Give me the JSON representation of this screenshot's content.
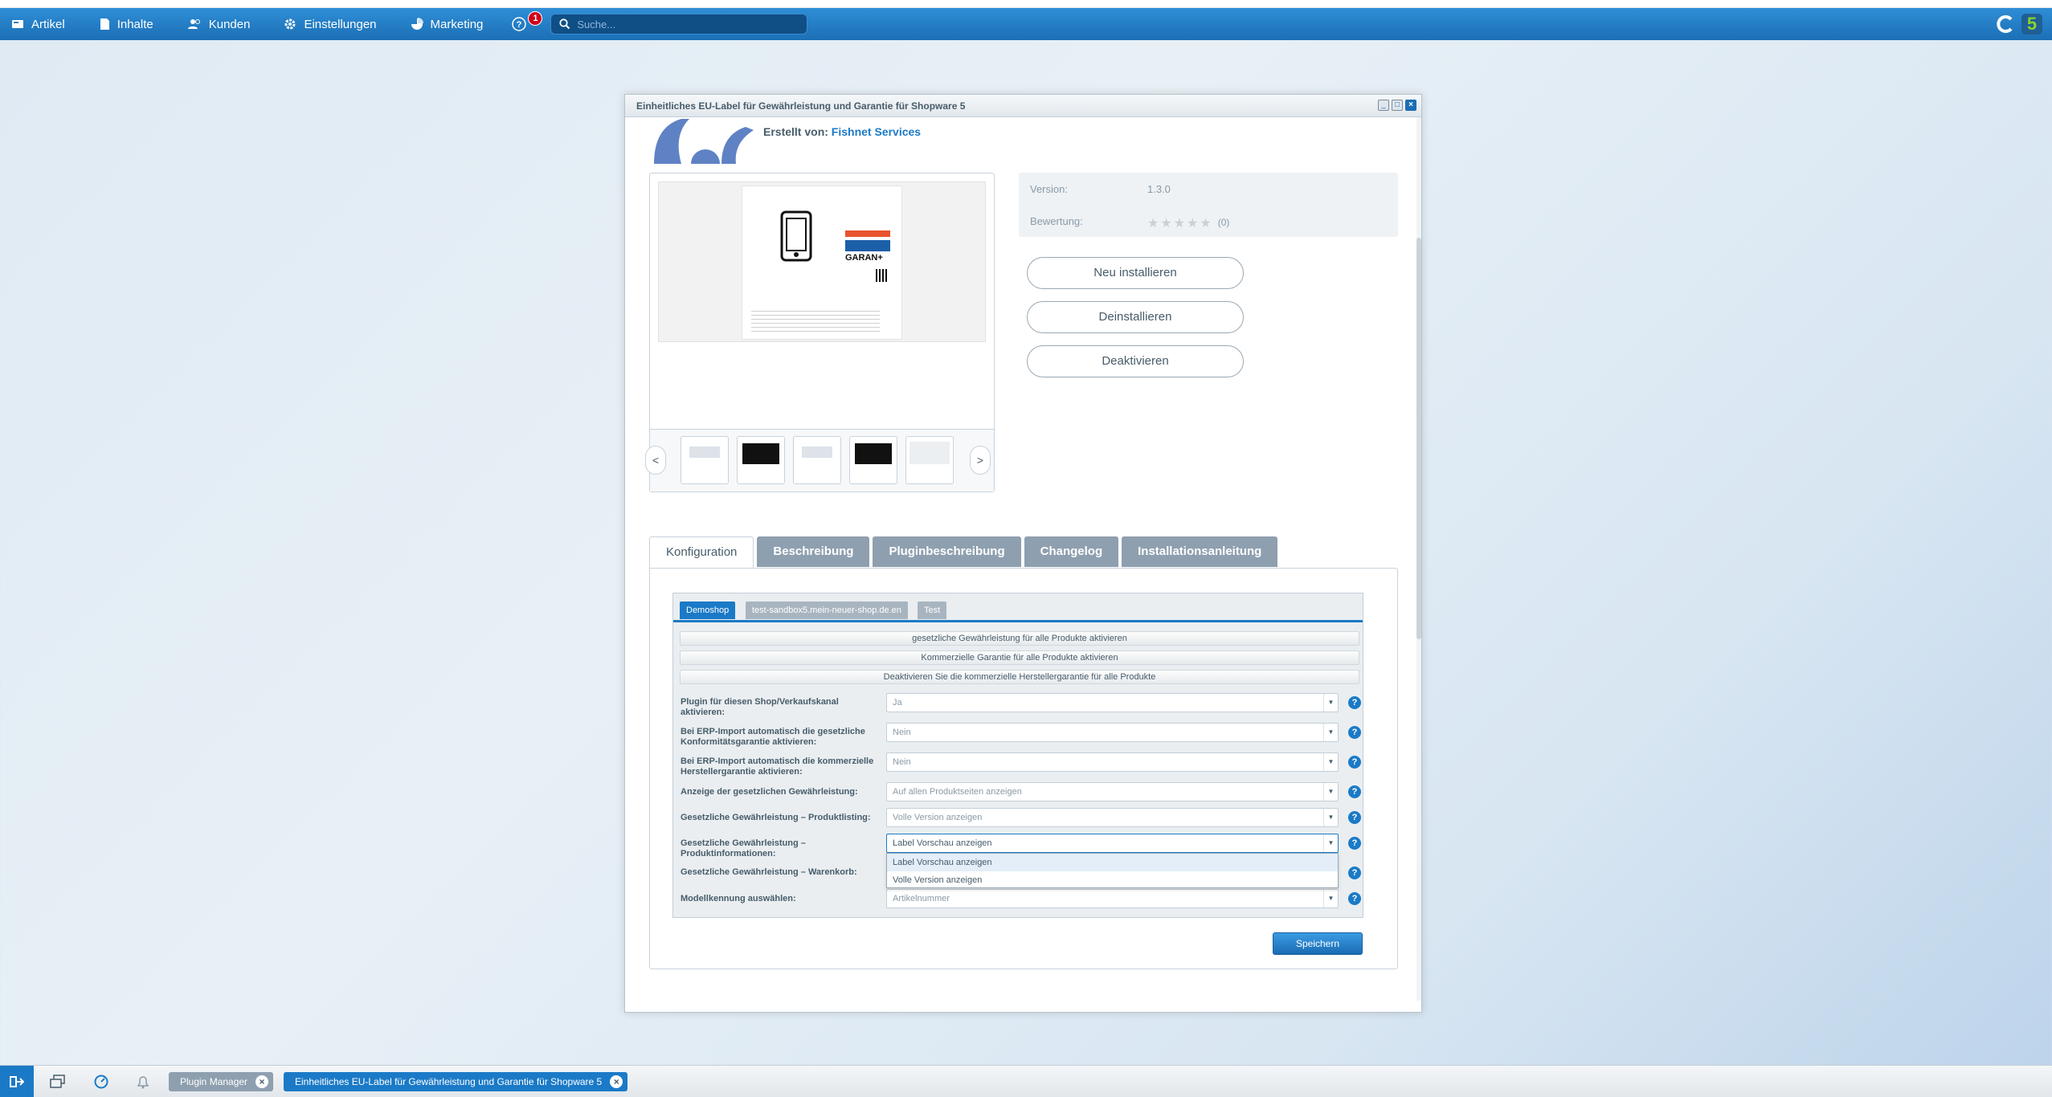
{
  "topbar": {
    "menu": [
      {
        "label": "Artikel",
        "icon": "article-icon"
      },
      {
        "label": "Inhalte",
        "icon": "content-icon"
      },
      {
        "label": "Kunden",
        "icon": "customers-icon"
      },
      {
        "label": "Einstellungen",
        "icon": "gear-icon"
      },
      {
        "label": "Marketing",
        "icon": "chart-icon"
      }
    ],
    "notification_count": "1",
    "search_placeholder": "Suche..."
  },
  "window": {
    "title": "Einheitliches EU-Label für Gewährleistung und Garantie für Shopware 5",
    "author_prefix": "Erstellt von:",
    "author_name": "Fishnet Services",
    "info": {
      "version_label": "Version:",
      "version_value": "1.3.0",
      "rating_label": "Bewertung:",
      "rating_stars": 0,
      "rating_count": "(0)"
    },
    "actions": {
      "reinstall": "Neu installieren",
      "uninstall": "Deinstallieren",
      "deactivate": "Deaktivieren"
    },
    "gallery": {
      "prev": "<",
      "next": ">",
      "preview_badge": "GARAN+"
    },
    "tabs": [
      "Konfiguration",
      "Beschreibung",
      "Pluginbeschreibung",
      "Changelog",
      "Installationsanleitung"
    ],
    "config": {
      "shop_tabs": [
        "Demoshop",
        "test-sandbox5.mein-neuer-shop.de.en",
        "Test"
      ],
      "bulk_buttons": [
        "gesetzliche Gewährleistung für alle Produkte aktivieren",
        "Kommerzielle Garantie für alle Produkte aktivieren",
        "Deaktivieren Sie die kommerzielle Herstellergarantie für alle Produkte"
      ],
      "fields": [
        {
          "label": "Plugin für diesen Shop/Verkaufskanal aktivieren:",
          "value": "Ja"
        },
        {
          "label": "Bei ERP-Import automatisch die gesetzliche Konformitätsgarantie aktivieren:",
          "value": "Nein"
        },
        {
          "label": "Bei ERP-Import automatisch die kommerzielle Herstellergarantie aktivieren:",
          "value": "Nein"
        },
        {
          "label": "Anzeige der gesetzlichen Gewährleistung:",
          "value": "Auf allen Produktseiten anzeigen"
        },
        {
          "label": "Gesetzliche Gewährleistung – Produktlisting:",
          "value": "Volle Version anzeigen"
        },
        {
          "label": "Gesetzliche Gewährleistung – Produktinformationen:",
          "value": "Label Vorschau anzeigen"
        },
        {
          "label": "Gesetzliche Gewährleistung – Warenkorb:",
          "value": ""
        },
        {
          "label": "Modellkennung auswählen:",
          "value": "Artikelnummer"
        }
      ],
      "dropdown_options": [
        "Label Vorschau anzeigen",
        "Volle Version anzeigen"
      ],
      "help": "?",
      "save": "Speichern"
    }
  },
  "taskbar": {
    "tabs": [
      {
        "label": "Plugin Manager"
      },
      {
        "label": "Einheitliches EU-Label für Gewährleistung und Garantie für Shopware 5"
      }
    ],
    "close": "×"
  },
  "colors": {
    "accent": "#1b7ac7",
    "topbar": "#2480c6",
    "badge": "#d0021b"
  }
}
